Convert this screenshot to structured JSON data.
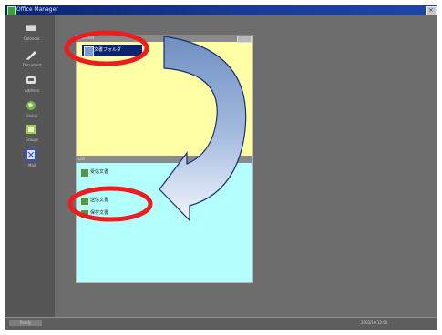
{
  "window": {
    "title": "Office Manager",
    "close_label": "×"
  },
  "sidebar": {
    "items": [
      {
        "label": "Calendar",
        "icon": "tray-icon"
      },
      {
        "label": "Document",
        "icon": "pen-icon"
      },
      {
        "label": "Address",
        "icon": "phone-icon"
      },
      {
        "label": "Global",
        "icon": "globe-icon"
      },
      {
        "label": "Groups",
        "icon": "group-icon"
      },
      {
        "label": "Mail",
        "icon": "mail-icon"
      }
    ]
  },
  "top_window": {
    "title": "Selected",
    "selected_item": "文書フォルダ"
  },
  "bottom_window": {
    "title": "List",
    "items": [
      {
        "label": "受信文書"
      },
      {
        "label": "送信文書"
      },
      {
        "label": "保存文書"
      }
    ]
  },
  "statusbar": {
    "left_text": "Ready",
    "right_text": "2003/10 12:00"
  },
  "colors": {
    "title_bar": "#0a2470",
    "desktop": "#6b6b6b",
    "top_window": "#ffffa6",
    "bottom_window": "#b3ffff",
    "highlight_ellipse": "#ee1c1c",
    "arrow_fill": "#7e9ccb"
  }
}
